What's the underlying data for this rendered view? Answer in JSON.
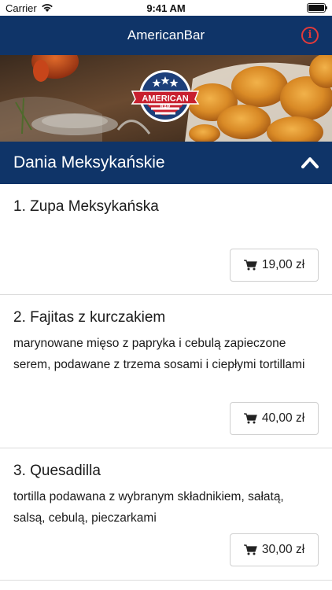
{
  "status_bar": {
    "carrier": "Carrier",
    "time": "9:41 AM"
  },
  "nav": {
    "title": "AmericanBar",
    "info_icon": "info-icon"
  },
  "banner": {
    "logo_top": "AMERICAN",
    "logo_bottom": "BAR",
    "accent_red": "#c8202f",
    "accent_blue": "#1d3f7a"
  },
  "category": {
    "title": "Dania Meksykańskie",
    "chevron_icon": "chevron-up-icon"
  },
  "menu": {
    "items": [
      {
        "name": "1. Zupa Meksykańska",
        "description": "",
        "price": "19,00 zł"
      },
      {
        "name": "2. Fajitas z kurczakiem",
        "description": "marynowane mięso z papryka i cebulą zapieczone serem, podawane z trzema sosami i ciepłymi tortillami",
        "price": "40,00 zł"
      },
      {
        "name": "3. Quesadilla",
        "description": "tortilla podawana z wybranym składnikiem, sałatą, salsą, cebulą, pieczarkami",
        "price": "30,00 zł"
      }
    ]
  },
  "colors": {
    "nav_bg": "#0f3468",
    "info_red": "#e23a3a",
    "divider": "#dcdcdc"
  }
}
